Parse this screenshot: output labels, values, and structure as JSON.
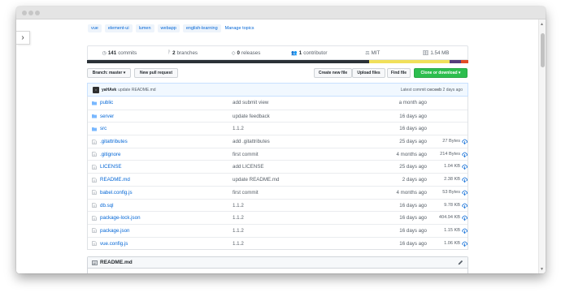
{
  "topics": [
    "vue",
    "element-ui",
    "lumen",
    "webapp",
    "english-learning"
  ],
  "manage_topics": "Manage topics",
  "numbers": {
    "commits": "141",
    "commits_label": "commits",
    "branches": "2",
    "branches_label": "branches",
    "releases": "0",
    "releases_label": "releases",
    "contributors": "1",
    "contributors_label": "contributor",
    "license": "MIT",
    "size": "1.54 MB"
  },
  "language_colors": [
    "#2b3137",
    "#f1e05a",
    "#563d7c",
    "#e34c26"
  ],
  "language_shares": [
    0.74,
    0.21,
    0.03,
    0.02
  ],
  "toolbar": {
    "branch": "Branch: master ▾",
    "new_pr": "New pull request",
    "create_file": "Create new file",
    "upload": "Upload files",
    "find": "Find file",
    "clone": "Clone or download ▾"
  },
  "commit": {
    "author": "yaHAvk",
    "message": "update README.md",
    "latest_label": "Latest commit",
    "sha": "ceceeb",
    "age": "2 days ago"
  },
  "files": [
    {
      "name": "public",
      "type": "dir",
      "message": "add submit view",
      "age": "a month ago",
      "size": ""
    },
    {
      "name": "server",
      "type": "dir",
      "message": "update feedback",
      "age": "16 days ago",
      "size": ""
    },
    {
      "name": "src",
      "type": "dir",
      "message": "1.1.2",
      "age": "16 days ago",
      "size": ""
    },
    {
      "name": ".gitattributes",
      "type": "file",
      "message": "add .gitattributes",
      "age": "25 days ago",
      "size": "27 Bytes"
    },
    {
      "name": ".gitignore",
      "type": "file",
      "message": "first commit",
      "age": "4 months ago",
      "size": "214 Bytes"
    },
    {
      "name": "LICENSE",
      "type": "file",
      "message": "add LICENSE",
      "age": "25 days ago",
      "size": "1.04 KB"
    },
    {
      "name": "README.md",
      "type": "file",
      "message": "update README.md",
      "age": "2 days ago",
      "size": "2.38 KB"
    },
    {
      "name": "babel.config.js",
      "type": "file",
      "message": "first commit",
      "age": "4 months ago",
      "size": "53 Bytes"
    },
    {
      "name": "db.sql",
      "type": "file",
      "message": "1.1.2",
      "age": "16 days ago",
      "size": "9.78 KB"
    },
    {
      "name": "package-lock.json",
      "type": "file",
      "message": "1.1.2",
      "age": "16 days ago",
      "size": "404.94 KB"
    },
    {
      "name": "package.json",
      "type": "file",
      "message": "1.1.2",
      "age": "16 days ago",
      "size": "1.15 KB"
    },
    {
      "name": "vue.config.js",
      "type": "file",
      "message": "1.1.2",
      "age": "16 days ago",
      "size": "1.06 KB"
    }
  ],
  "readme": {
    "title": "README.md"
  }
}
